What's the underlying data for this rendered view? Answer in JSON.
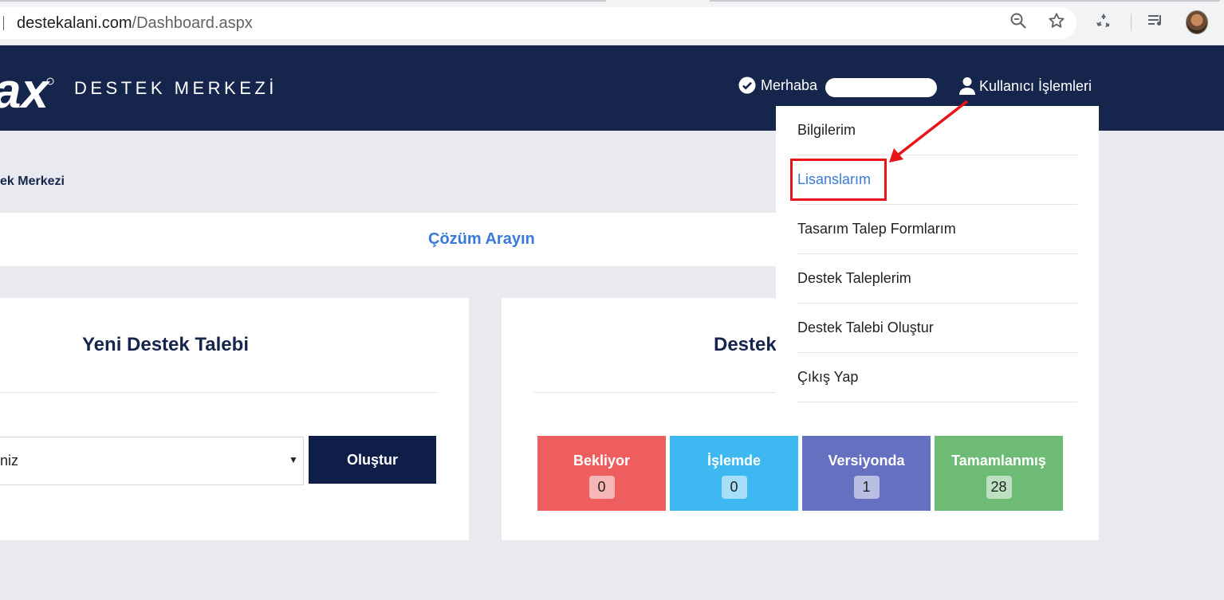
{
  "browser": {
    "url_domain": "destekalani.com",
    "url_path": "/Dashboard.aspx",
    "icons": [
      "zoom-icon",
      "bookmark-star-icon",
      "recycle-extension-icon",
      "media-playlist-icon",
      "profile-avatar"
    ]
  },
  "header": {
    "logo_text": "ax",
    "brand": "DESTEK MERKEZİ",
    "greeting": "Merhaba",
    "user_menu_label": "Kullanıcı İşlemleri",
    "colors": {
      "header_bg": "#16254b",
      "accent": "#3a79d9"
    }
  },
  "breadcrumb": "ek Merkezi",
  "search": {
    "link_label": "Çözüm Arayın"
  },
  "new_ticket": {
    "title": "Yeni Destek Talebi",
    "select_value": "niz",
    "button_label": "Oluştur"
  },
  "tickets": {
    "title": "Destek",
    "stats": [
      {
        "label": "Bekliyor",
        "count": "0",
        "color": "#ee5e5e"
      },
      {
        "label": "İşlemde",
        "count": "0",
        "color": "#3db8f0"
      },
      {
        "label": "Versiyonda",
        "count": "1",
        "color": "#6570c0"
      },
      {
        "label": "Tamamlanmış",
        "count": "28",
        "color": "#6dbb74"
      }
    ]
  },
  "dropdown": {
    "items": [
      {
        "label": "Bilgilerim",
        "active": false
      },
      {
        "label": "Lisanslarım",
        "active": true
      },
      {
        "label": "Tasarım Talep Formlarım",
        "active": false
      },
      {
        "label": "Destek Taleplerim",
        "active": false
      },
      {
        "label": "Destek Talebi Oluştur",
        "active": false
      },
      {
        "label": "Çıkış Yap",
        "active": false
      }
    ],
    "highlight_color": "#e8141a"
  }
}
